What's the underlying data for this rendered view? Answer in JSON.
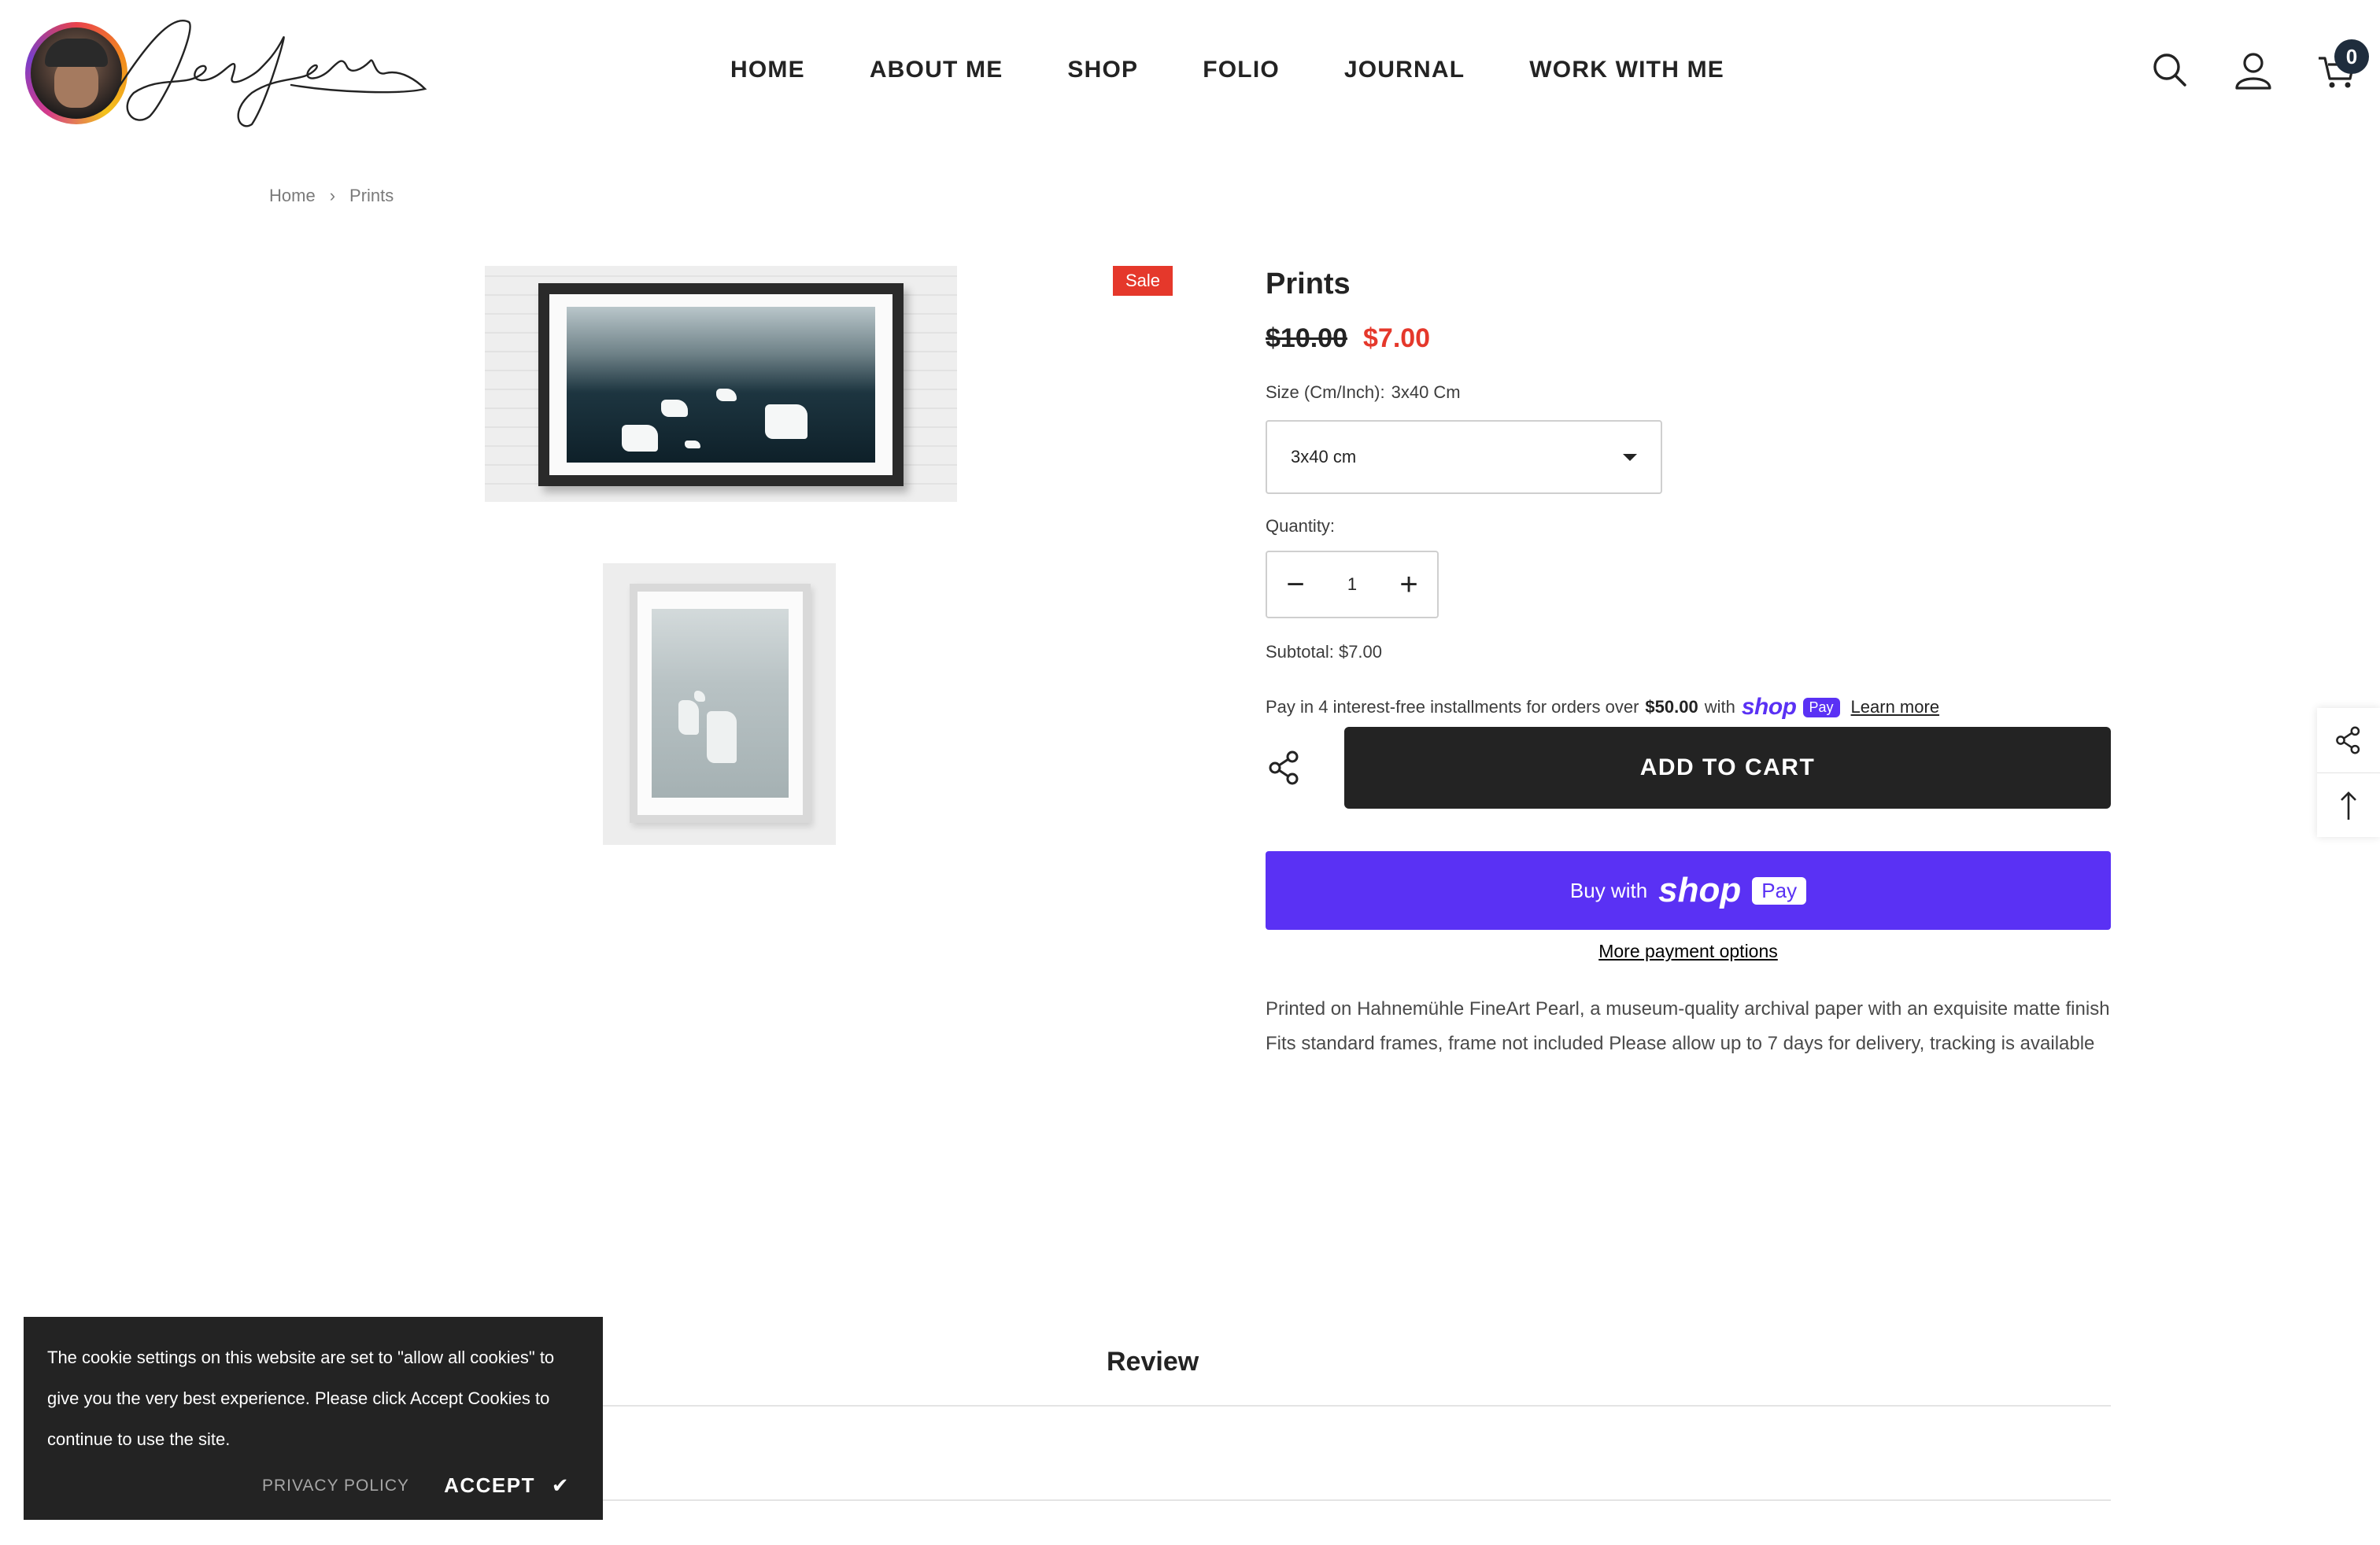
{
  "header": {
    "nav": [
      "HOME",
      "ABOUT ME",
      "SHOP",
      "FOLIO",
      "JOURNAL",
      "WORK WITH ME"
    ],
    "cart_count": "0",
    "icons": [
      "search-icon",
      "account-icon",
      "cart-icon"
    ]
  },
  "breadcrumb": {
    "home": "Home",
    "current": "Prints"
  },
  "gallery": {
    "sale_badge": "Sale"
  },
  "product": {
    "title": "Prints",
    "price_old": "$10.00",
    "price_new": "$7.00",
    "size_label": "Size (Cm/Inch):",
    "size_value": "3x40 Cm",
    "size_selected": "3x40 cm",
    "quantity_label": "Quantity:",
    "quantity": "1",
    "subtotal": "Subtotal: $7.00",
    "installments_pre": "Pay in 4 interest-free installments for orders over",
    "installments_amount": "$50.00",
    "installments_with": "with",
    "shop_word": "shop",
    "pay_word": "Pay",
    "learn_more": "Learn more",
    "add_to_cart": "ADD TO CART",
    "buy_with": "Buy with",
    "more_payment": "More payment options",
    "description": "Printed on Hahnemühle FineArt Pearl, a museum-quality archival paper with an exquisite matte finish Fits standard frames, frame not included Please allow up to 7 days for delivery, tracking is available"
  },
  "tabs": {
    "review": "Review"
  },
  "cookie": {
    "text": "The cookie settings on this website are set to \"allow all cookies\" to give you the very best experience. Please click Accept Cookies to continue to use the site.",
    "privacy": "PRIVACY POLICY",
    "accept": "ACCEPT",
    "accept_check": "✔"
  },
  "colors": {
    "accent_sale": "#e5382b",
    "shop_pay": "#5a31f4",
    "dark": "#232323"
  }
}
